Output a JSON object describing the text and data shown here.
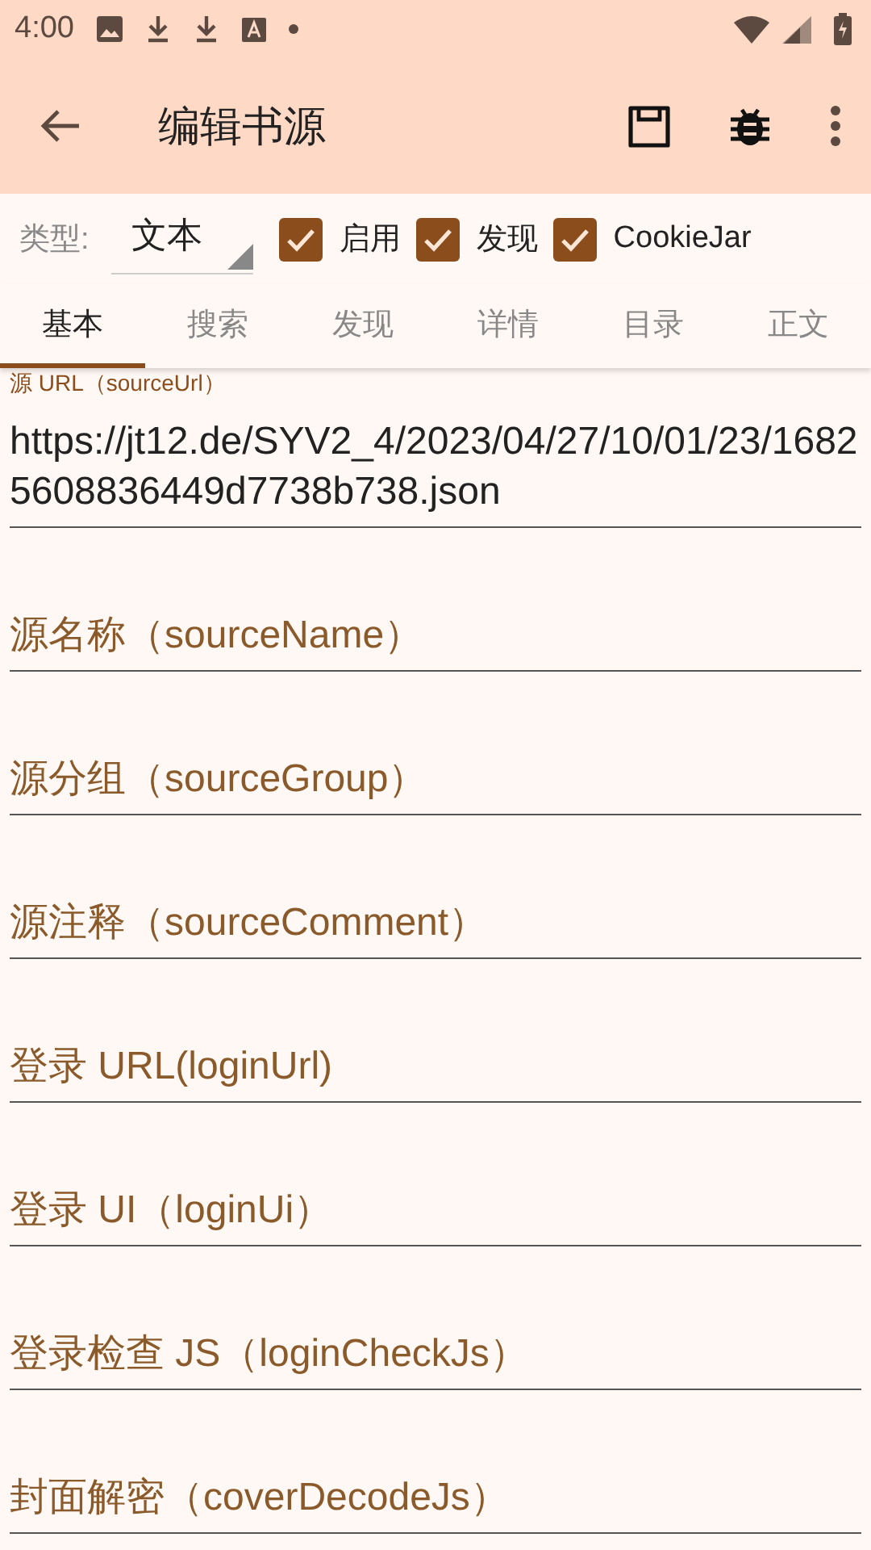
{
  "status_bar": {
    "time": "4:00"
  },
  "app_bar": {
    "title": "编辑书源"
  },
  "type_row": {
    "label": "类型:",
    "dropdown": "文本",
    "checkboxes": [
      {
        "label": "启用",
        "checked": true
      },
      {
        "label": "发现",
        "checked": true
      },
      {
        "label": "CookieJar",
        "checked": true
      }
    ]
  },
  "tabs": [
    {
      "label": "基本",
      "selected": true
    },
    {
      "label": "搜索",
      "selected": false
    },
    {
      "label": "发现",
      "selected": false
    },
    {
      "label": "详情",
      "selected": false
    },
    {
      "label": "目录",
      "selected": false
    },
    {
      "label": "正文",
      "selected": false
    }
  ],
  "fields": [
    {
      "label": "源 URL（sourceUrl）",
      "value": "https://jt12.de/SYV2_4/2023/04/27/10/01/23/16825608836449d7738b738.json"
    },
    {
      "placeholder": "源名称（sourceName）"
    },
    {
      "placeholder": "源分组（sourceGroup）"
    },
    {
      "placeholder": "源注释（sourceComment）"
    },
    {
      "placeholder": "登录 URL(loginUrl)"
    },
    {
      "placeholder": "登录 UI（loginUi）"
    },
    {
      "placeholder": "登录检查 JS（loginCheckJs）"
    },
    {
      "placeholder": "封面解密（coverDecodeJs）"
    }
  ]
}
